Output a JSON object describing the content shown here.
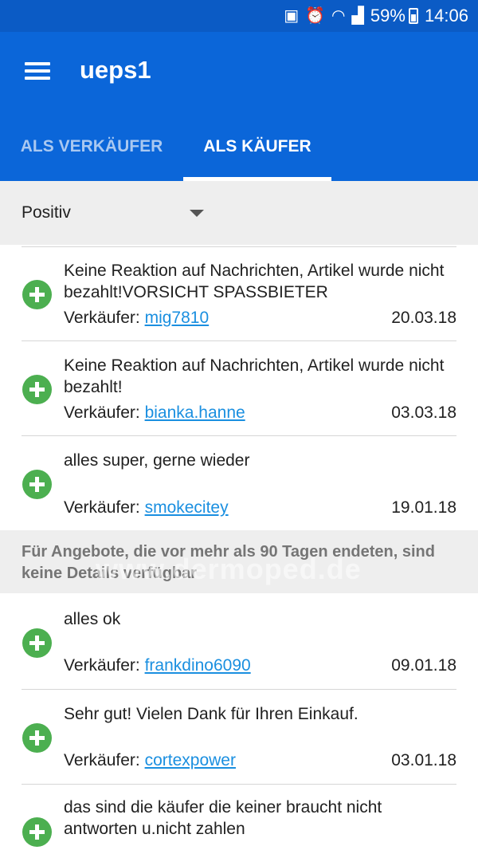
{
  "status_bar": {
    "battery_percent": "59%",
    "time": "14:06"
  },
  "app_bar": {
    "title": "ueps1"
  },
  "tabs": [
    {
      "label": "ALS VERKÄUFER",
      "active": false
    },
    {
      "label": "ALS KÄUFER",
      "active": true
    }
  ],
  "filter": {
    "selected": "Positiv"
  },
  "seller_prefix": "Verkäufer:",
  "feedback_items": [
    {
      "comment": "Keine Reaktion auf Nachrichten, Artikel wurde nicht bezahlt!VORSICHT SPASSBIETER",
      "seller": "mig7810",
      "date": "20.03.18",
      "rating": "positive"
    },
    {
      "comment": "Keine Reaktion auf Nachrichten, Artikel wurde nicht bezahlt!",
      "seller": "bianka.hanne",
      "date": "03.03.18",
      "rating": "positive"
    },
    {
      "comment": "alles super, gerne wieder",
      "seller": "smokecitey",
      "date": "19.01.18",
      "rating": "positive"
    }
  ],
  "notice": {
    "text": "Für Angebote, die vor mehr als 90 Tagen endeten, sind keine Details verfügbar",
    "watermark": "www.dermoped.de"
  },
  "older_items": [
    {
      "comment": "alles ok",
      "seller": "frankdino6090",
      "date": "09.01.18",
      "rating": "positive"
    },
    {
      "comment": "Sehr gut! Vielen Dank für Ihren Einkauf.",
      "seller": "cortexpower",
      "date": "03.01.18",
      "rating": "positive"
    },
    {
      "comment": "das sind die käufer die keiner braucht nicht antworten u.nicht zahlen",
      "seller": "",
      "date": "",
      "rating": "positive"
    }
  ],
  "colors": {
    "primary": "#0b66d9",
    "status_bar": "#0b5bc5",
    "positive": "#4caf50",
    "link": "#1a8fe0"
  }
}
